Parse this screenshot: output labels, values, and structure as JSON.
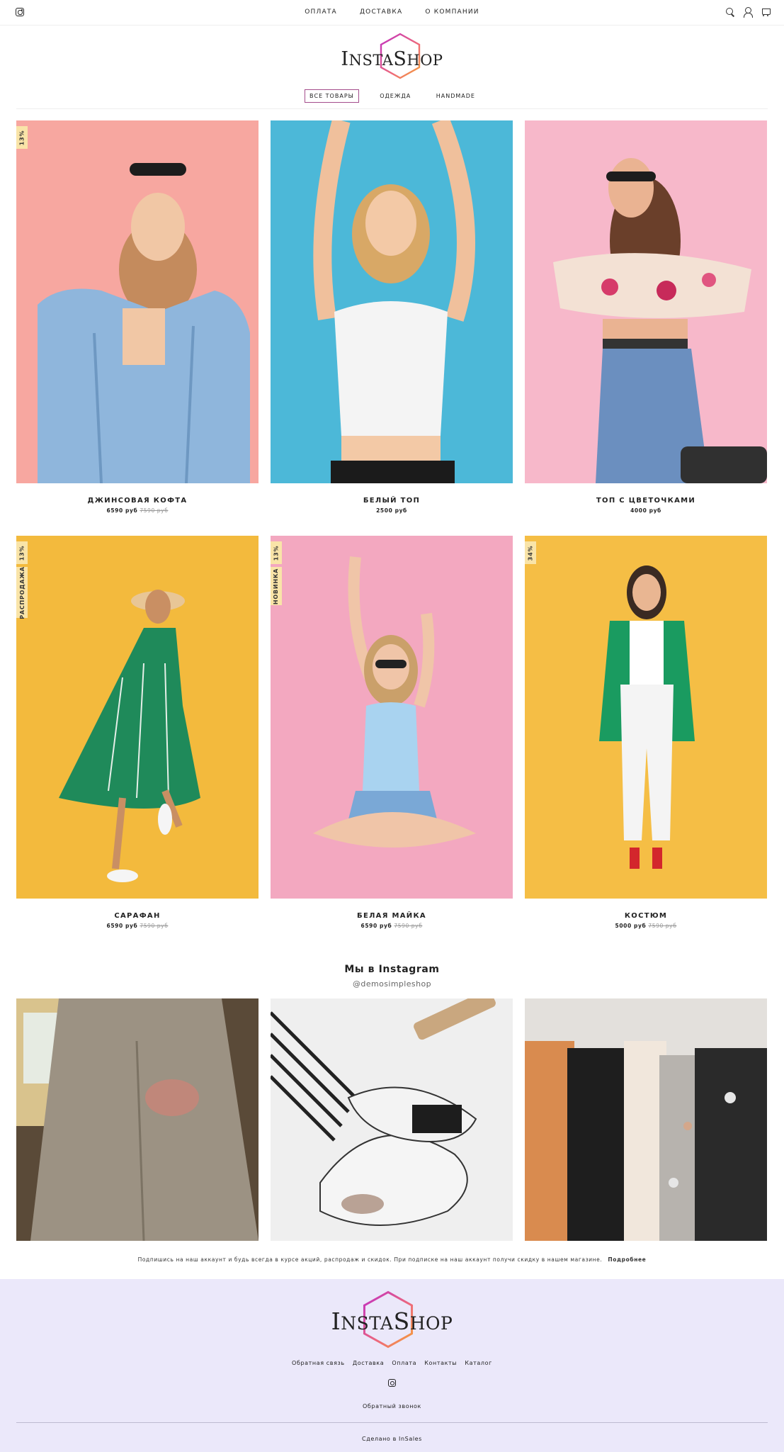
{
  "header": {
    "instagram_icon": "instagram-icon",
    "nav": [
      "ОПЛАТА",
      "ДОСТАВКА",
      "О КОМПАНИИ"
    ],
    "icons": [
      "search-icon",
      "user-icon",
      "cart-icon"
    ]
  },
  "logo": {
    "text_big": "I",
    "text_mid": "NSTA",
    "text_big2": "S",
    "text_end": "HOP"
  },
  "categories": {
    "items": [
      "ВСЕ ТОВАРЫ",
      "ОДЕЖДА",
      "HANDMADE"
    ],
    "active": "ВСЕ ТОВАРЫ"
  },
  "products": [
    {
      "name": "ДЖИНСОВАЯ КОФТА",
      "price": "6590 руб",
      "old_price": "7590 руб",
      "badges": [
        "13%"
      ],
      "bg": "#f7a7a0"
    },
    {
      "name": "БЕЛЫЙ ТОП",
      "price": "2500 руб",
      "old_price": "",
      "badges": [],
      "bg": "#4cb8d8"
    },
    {
      "name": "ТОП С ЦВЕТОЧКАМИ",
      "price": "4000 руб",
      "old_price": "",
      "badges": [],
      "bg": "#f7b8ca"
    },
    {
      "name": "САРАФАН",
      "price": "6590 руб",
      "old_price": "7590 руб",
      "badges": [
        "13%",
        "РАСПРОДАЖА"
      ],
      "bg": "#f3ba3d"
    },
    {
      "name": "БЕЛАЯ МАЙКА",
      "price": "6590 руб",
      "old_price": "7590 руб",
      "badges": [
        "13%",
        "НОВИНКА"
      ],
      "bg": "#f3a8c0"
    },
    {
      "name": "КОСТЮМ",
      "price": "5000 руб",
      "old_price": "7590 руб",
      "badges": [
        "34%"
      ],
      "bg": "#f5be45"
    }
  ],
  "instagram": {
    "title": "Мы в Instagram",
    "handle": "@demosimpleshop",
    "subscribe_text": "Подпишись на наш аккаунт и будь всегда в курсе акций, распродаж и скидок. При подписке на наш аккаунт получи скидку в нашем магазине.",
    "more_link": "Подробнее"
  },
  "footer": {
    "nav": [
      "Обратная связь",
      "Доставка",
      "Оплата",
      "Контакты",
      "Каталог"
    ],
    "callback": "Обратный звонок",
    "made_by": "Сделано в InSales"
  },
  "colors": {
    "accent": "#a44d8c",
    "footer_bg": "#ebe8fa",
    "badge_bg": "#f9e4a8"
  }
}
